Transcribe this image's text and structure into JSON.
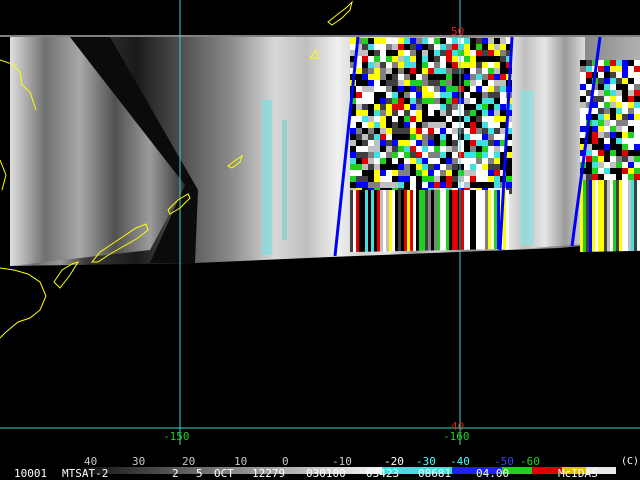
{
  "satellite_image": {
    "lat_labels": [
      "50",
      "40"
    ],
    "lon_labels": [
      "-150",
      "-160"
    ],
    "colorbar": {
      "labels": [
        "40",
        "30",
        "20",
        "10",
        "0",
        "-10",
        "-20",
        "-30",
        "-40",
        "-50",
        "-60"
      ],
      "label_colors": [
        "#c8c8c8",
        "#c8c8c8",
        "#c8c8c8",
        "#c8c8c8",
        "#c8c8c8",
        "#c8c8c8",
        "#ffffff",
        "#40ffff",
        "#40ffff",
        "#4040ff",
        "#20d020"
      ]
    },
    "footer": {
      "frame": "10001",
      "satellite": "MTSAT-2",
      "band": "2",
      "day": "5",
      "month": "OCT",
      "julian": "12279",
      "time": "030100",
      "line": "03423",
      "element": "08681",
      "res": "04.00",
      "software": "McIDAS"
    },
    "copyright": "(C)",
    "colors": {
      "grid": "#40d0d0",
      "coast": "#ffff00",
      "lat_label": "#e02020",
      "lon_label": "#20d020"
    }
  }
}
